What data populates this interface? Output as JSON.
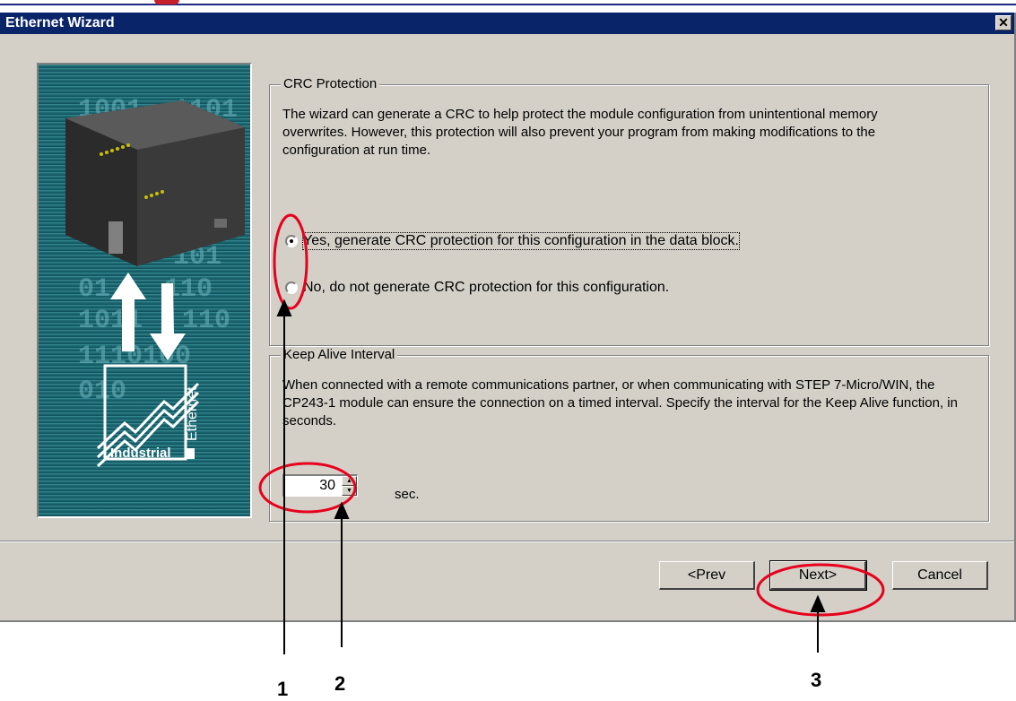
{
  "window": {
    "title": "Ethernet Wizard",
    "close_glyph": "✕"
  },
  "image_panel": {
    "binary_text": [
      "1001",
      "1101",
      "01",
      "1",
      "101",
      "01",
      "0",
      "110",
      "1011",
      "110",
      "1110100",
      "010",
      "0"
    ],
    "logo_label": "Industrial",
    "logo_side_label": "Ethernet"
  },
  "crc": {
    "title": "CRC Protection",
    "description": "The wizard can generate a CRC to help protect the module configuration from unintentional memory overwrites. However, this protection will also prevent your program from making modifications to the configuration at run time.",
    "options": [
      {
        "label": "Yes, generate CRC protection for this configuration in the data block.",
        "selected": true
      },
      {
        "label": "No, do not generate CRC protection for this configuration.",
        "selected": false
      }
    ]
  },
  "keepalive": {
    "title": "Keep Alive Interval",
    "description": "When connected with a remote communications partner, or when communicating with STEP 7-Micro/WIN, the CP243-1 module can ensure the connection on a timed interval. Specify the interval for the Keep Alive function, in seconds.",
    "value": "30",
    "unit": "sec."
  },
  "buttons": {
    "prev": "<Prev",
    "next": "Next>",
    "cancel": "Cancel"
  },
  "annotations": {
    "n1": "1",
    "n2": "2",
    "n3": "3"
  },
  "colors": {
    "title_bar": "#0a246a",
    "dialog_bg": "#d4d0c8",
    "annotation_red": "#e8001c",
    "panel_teal": "#1f6f78"
  }
}
